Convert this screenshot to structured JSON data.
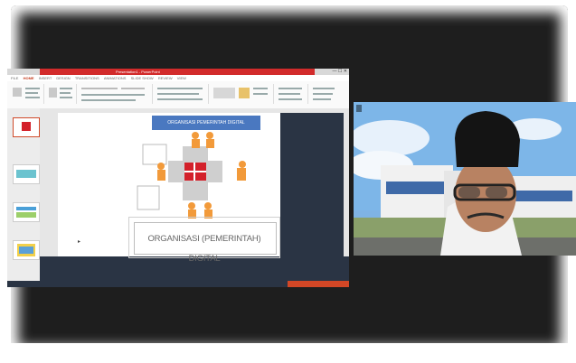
{
  "share": {
    "window_title": "Presentation1 - PowerPoint",
    "window_controls": "— ☐ ✕",
    "ribbon_tabs": [
      "FILE",
      "HOME",
      "INSERT",
      "DESIGN",
      "TRANSITIONS",
      "ANIMATIONS",
      "SLIDE SHOW",
      "REVIEW",
      "VIEW"
    ],
    "active_tab_index": 1
  },
  "slide": {
    "title_box": "ORGANISASI PEMERINTAH DIGITAL",
    "caption": "ORGANISASI (PEMERINTAH) DIGITAL"
  },
  "camera": {
    "label": "",
    "name": ""
  },
  "colors": {
    "accent_red": "#d22b2b",
    "slide_title_bg": "#4a78c0",
    "puzzle_red": "#d3202a",
    "figure_orange": "#f29a3a"
  }
}
